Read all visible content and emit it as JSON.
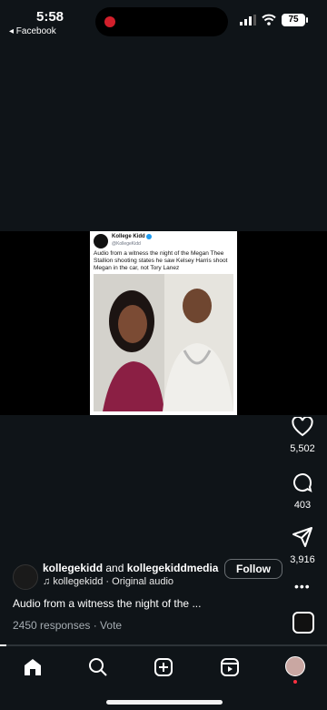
{
  "status": {
    "time": "5:58",
    "back_label": "◂ Facebook",
    "battery": "75"
  },
  "post": {
    "tweet_name": "Kollege Kidd",
    "tweet_handle": "@KollegeKidd",
    "tweet_text": "Audio from a witness the night of the Megan Thee Stallion shooting states he saw Kelsey Harris shoot Megan in the car, not Tory Lanez"
  },
  "actions": {
    "likes": "5,502",
    "comments": "403",
    "shares": "3,916"
  },
  "author": {
    "username": "kollegekidd",
    "and_text": "and",
    "collaborator": "kollegekiddmedia",
    "audio_handle": "kollegekidd",
    "audio_label": "Original audio",
    "follow_label": "Follow"
  },
  "caption": "Audio from a witness the night of the ...",
  "responses": "2450 responses · Vote",
  "progress": 0.02,
  "tabs": [
    "home-icon",
    "search-icon",
    "create-icon",
    "reels-icon",
    "profile-avatar"
  ],
  "colors": {
    "background": "#0f1418",
    "notification": "#ff3040",
    "record": "#d21f2b"
  }
}
